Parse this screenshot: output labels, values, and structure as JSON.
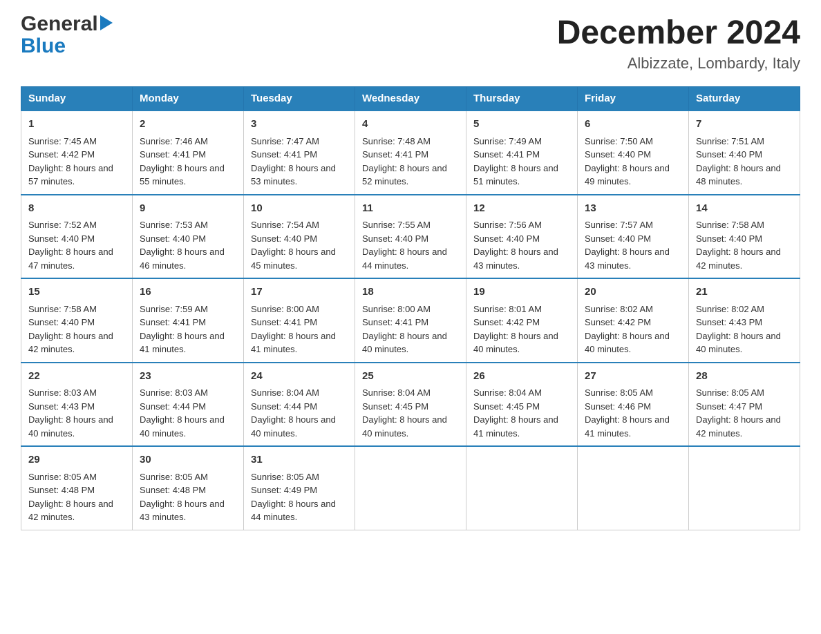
{
  "header": {
    "logo_general": "General",
    "logo_blue": "Blue",
    "month_title": "December 2024",
    "location": "Albizzate, Lombardy, Italy"
  },
  "days_of_week": [
    "Sunday",
    "Monday",
    "Tuesday",
    "Wednesday",
    "Thursday",
    "Friday",
    "Saturday"
  ],
  "weeks": [
    [
      {
        "day": "1",
        "sunrise": "7:45 AM",
        "sunset": "4:42 PM",
        "daylight": "8 hours and 57 minutes."
      },
      {
        "day": "2",
        "sunrise": "7:46 AM",
        "sunset": "4:41 PM",
        "daylight": "8 hours and 55 minutes."
      },
      {
        "day": "3",
        "sunrise": "7:47 AM",
        "sunset": "4:41 PM",
        "daylight": "8 hours and 53 minutes."
      },
      {
        "day": "4",
        "sunrise": "7:48 AM",
        "sunset": "4:41 PM",
        "daylight": "8 hours and 52 minutes."
      },
      {
        "day": "5",
        "sunrise": "7:49 AM",
        "sunset": "4:41 PM",
        "daylight": "8 hours and 51 minutes."
      },
      {
        "day": "6",
        "sunrise": "7:50 AM",
        "sunset": "4:40 PM",
        "daylight": "8 hours and 49 minutes."
      },
      {
        "day": "7",
        "sunrise": "7:51 AM",
        "sunset": "4:40 PM",
        "daylight": "8 hours and 48 minutes."
      }
    ],
    [
      {
        "day": "8",
        "sunrise": "7:52 AM",
        "sunset": "4:40 PM",
        "daylight": "8 hours and 47 minutes."
      },
      {
        "day": "9",
        "sunrise": "7:53 AM",
        "sunset": "4:40 PM",
        "daylight": "8 hours and 46 minutes."
      },
      {
        "day": "10",
        "sunrise": "7:54 AM",
        "sunset": "4:40 PM",
        "daylight": "8 hours and 45 minutes."
      },
      {
        "day": "11",
        "sunrise": "7:55 AM",
        "sunset": "4:40 PM",
        "daylight": "8 hours and 44 minutes."
      },
      {
        "day": "12",
        "sunrise": "7:56 AM",
        "sunset": "4:40 PM",
        "daylight": "8 hours and 43 minutes."
      },
      {
        "day": "13",
        "sunrise": "7:57 AM",
        "sunset": "4:40 PM",
        "daylight": "8 hours and 43 minutes."
      },
      {
        "day": "14",
        "sunrise": "7:58 AM",
        "sunset": "4:40 PM",
        "daylight": "8 hours and 42 minutes."
      }
    ],
    [
      {
        "day": "15",
        "sunrise": "7:58 AM",
        "sunset": "4:40 PM",
        "daylight": "8 hours and 42 minutes."
      },
      {
        "day": "16",
        "sunrise": "7:59 AM",
        "sunset": "4:41 PM",
        "daylight": "8 hours and 41 minutes."
      },
      {
        "day": "17",
        "sunrise": "8:00 AM",
        "sunset": "4:41 PM",
        "daylight": "8 hours and 41 minutes."
      },
      {
        "day": "18",
        "sunrise": "8:00 AM",
        "sunset": "4:41 PM",
        "daylight": "8 hours and 40 minutes."
      },
      {
        "day": "19",
        "sunrise": "8:01 AM",
        "sunset": "4:42 PM",
        "daylight": "8 hours and 40 minutes."
      },
      {
        "day": "20",
        "sunrise": "8:02 AM",
        "sunset": "4:42 PM",
        "daylight": "8 hours and 40 minutes."
      },
      {
        "day": "21",
        "sunrise": "8:02 AM",
        "sunset": "4:43 PM",
        "daylight": "8 hours and 40 minutes."
      }
    ],
    [
      {
        "day": "22",
        "sunrise": "8:03 AM",
        "sunset": "4:43 PM",
        "daylight": "8 hours and 40 minutes."
      },
      {
        "day": "23",
        "sunrise": "8:03 AM",
        "sunset": "4:44 PM",
        "daylight": "8 hours and 40 minutes."
      },
      {
        "day": "24",
        "sunrise": "8:04 AM",
        "sunset": "4:44 PM",
        "daylight": "8 hours and 40 minutes."
      },
      {
        "day": "25",
        "sunrise": "8:04 AM",
        "sunset": "4:45 PM",
        "daylight": "8 hours and 40 minutes."
      },
      {
        "day": "26",
        "sunrise": "8:04 AM",
        "sunset": "4:45 PM",
        "daylight": "8 hours and 41 minutes."
      },
      {
        "day": "27",
        "sunrise": "8:05 AM",
        "sunset": "4:46 PM",
        "daylight": "8 hours and 41 minutes."
      },
      {
        "day": "28",
        "sunrise": "8:05 AM",
        "sunset": "4:47 PM",
        "daylight": "8 hours and 42 minutes."
      }
    ],
    [
      {
        "day": "29",
        "sunrise": "8:05 AM",
        "sunset": "4:48 PM",
        "daylight": "8 hours and 42 minutes."
      },
      {
        "day": "30",
        "sunrise": "8:05 AM",
        "sunset": "4:48 PM",
        "daylight": "8 hours and 43 minutes."
      },
      {
        "day": "31",
        "sunrise": "8:05 AM",
        "sunset": "4:49 PM",
        "daylight": "8 hours and 44 minutes."
      },
      null,
      null,
      null,
      null
    ]
  ],
  "labels": {
    "sunrise": "Sunrise:",
    "sunset": "Sunset:",
    "daylight": "Daylight:"
  }
}
